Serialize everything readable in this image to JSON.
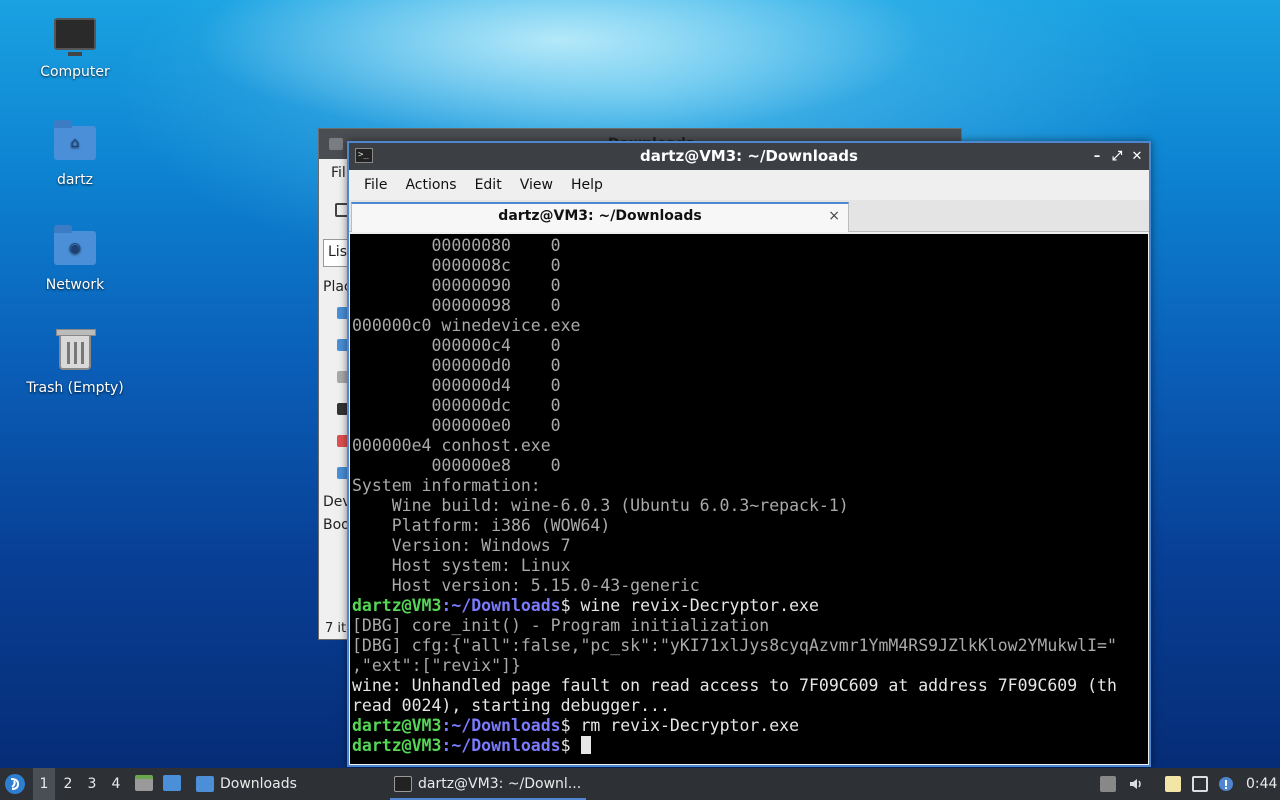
{
  "desktop": {
    "icons": [
      {
        "label": "Computer",
        "icon": "computer-icon"
      },
      {
        "label": "dartz",
        "icon": "home-folder-icon"
      },
      {
        "label": "Network",
        "icon": "network-folder-icon"
      },
      {
        "label": "Trash (Empty)",
        "icon": "trash-icon"
      }
    ]
  },
  "file_manager": {
    "title_fragment": "Downloads",
    "menu_fragment": "Fil",
    "view_fragment": "List",
    "places_fragment": "Plac",
    "devices_fragment": "Dev",
    "bookmarks_fragment": "Boo",
    "status_fragment": "7 it"
  },
  "terminal": {
    "title": "dartz@VM3: ~/Downloads",
    "menu": [
      "File",
      "Actions",
      "Edit",
      "View",
      "Help"
    ],
    "tab_label": "dartz@VM3: ~/Downloads",
    "tab_close": "×",
    "window_buttons": {
      "minimize": "–",
      "maximize": "⤢",
      "close": "✕"
    },
    "prompt_user": "dartz@VM3",
    "prompt_path": ":~/Downloads",
    "prompt_symbol": "$",
    "lines": [
      "        00000080    0",
      "        0000008c    0",
      "        00000090    0",
      "        00000098    0",
      "000000c0 winedevice.exe",
      "        000000c4    0",
      "        000000d0    0",
      "        000000d4    0",
      "        000000dc    0",
      "        000000e0    0",
      "000000e4 conhost.exe",
      "        000000e8    0",
      "System information:",
      "    Wine build: wine-6.0.3 (Ubuntu 6.0.3~repack-1)",
      "    Platform: i386 (WOW64)",
      "    Version: Windows 7",
      "    Host system: Linux",
      "    Host version: 5.15.0-43-generic"
    ],
    "cmd1": " wine revix-Decryptor.exe",
    "out_lines": [
      "[DBG] core_init() - Program initialization",
      "[DBG] cfg:{\"all\":false,\"pc_sk\":\"yKI71xlJys8cyqAzvmr1YmM4RS9JZlkKlow2YMukwlI=\"",
      ",\"ext\":[\"revix\"]}",
      "wine: Unhandled page fault on read access to 7F09C609 at address 7F09C609 (th",
      "read 0024), starting debugger..."
    ],
    "cmd2": " rm revix-Decryptor.exe",
    "cmd3": " "
  },
  "taskbar": {
    "workspaces": [
      "1",
      "2",
      "3",
      "4"
    ],
    "active_workspace": "1",
    "tasks": [
      {
        "label": "Downloads",
        "icon": "folder-icon"
      },
      {
        "label": "dartz@VM3: ~/Downl...",
        "icon": "terminal-icon"
      }
    ],
    "clock": "0:44"
  },
  "colors": {
    "prompt_user": "#55d655",
    "prompt_path": "#7b7bff",
    "accent": "#4f86d0"
  }
}
